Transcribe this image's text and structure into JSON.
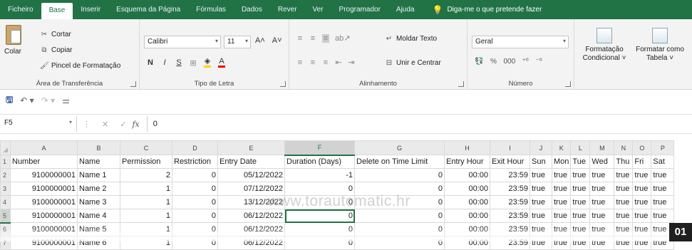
{
  "ribbon_tabs": [
    {
      "label": "Ficheiro",
      "active": false
    },
    {
      "label": "Base",
      "active": true
    },
    {
      "label": "Inserir",
      "active": false
    },
    {
      "label": "Esquema da Página",
      "active": false
    },
    {
      "label": "Fórmulas",
      "active": false
    },
    {
      "label": "Dados",
      "active": false
    },
    {
      "label": "Rever",
      "active": false
    },
    {
      "label": "Ver",
      "active": false
    },
    {
      "label": "Programador",
      "active": false
    },
    {
      "label": "Ajuda",
      "active": false
    }
  ],
  "tell_me": {
    "icon": "lightbulb-icon",
    "label": "Diga-me o que pretende fazer"
  },
  "clipboard": {
    "paste": "Colar",
    "cut": "Cortar",
    "copy": "Copiar",
    "format_painter": "Pincel de Formatação",
    "group_label": "Área de Transferência"
  },
  "font": {
    "name": "Calibri",
    "size": "11",
    "grow": "A˄",
    "shrink": "A˅",
    "bold": "N",
    "italic": "I",
    "underline": "S",
    "group_label": "Tipo de Letra"
  },
  "alignment": {
    "wrap_text": "Moldar Texto",
    "merge_center": "Unir e Centrar",
    "group_label": "Alinhamento"
  },
  "number": {
    "format": "Geral",
    "percent": "%",
    "thousands": "000",
    "group_label": "Número"
  },
  "styles": {
    "conditional_formatting": [
      "Formatação",
      "Condicional ˅"
    ],
    "format_as_table": [
      "Formatar como",
      "Tabela ˅"
    ]
  },
  "colors": {
    "ribbon_green": "#217346",
    "selection_green": "#217346"
  },
  "formula_bar": {
    "name_box": "F5",
    "fx": "fx",
    "value": "0"
  },
  "grid": {
    "column_headers": [
      "A",
      "B",
      "C",
      "D",
      "E",
      "F",
      "G",
      "H",
      "I",
      "J",
      "K",
      "L",
      "M",
      "N",
      "O",
      "P"
    ],
    "rows": [
      {
        "n": "1",
        "cells": [
          "Number",
          "Name",
          "Permission",
          "Restriction",
          "Entry Date",
          "Duration (Days)",
          "Delete on Time Limit",
          "Entry Hour",
          "Exit Hour",
          "Sun",
          "Mon",
          "Tue",
          "Wed",
          "Thu",
          "Fri",
          "Sat"
        ]
      },
      {
        "n": "2",
        "cells": [
          "9100000001",
          "Name 1",
          "2",
          "0",
          "05/12/2022",
          "-1",
          "0",
          "00:00",
          "23:59",
          "true",
          "true",
          "true",
          "true",
          "true",
          "true",
          "true"
        ]
      },
      {
        "n": "3",
        "cells": [
          "9100000001",
          "Name 2",
          "1",
          "0",
          "07/12/2022",
          "0",
          "0",
          "00:00",
          "23:59",
          "true",
          "true",
          "true",
          "true",
          "true",
          "true",
          "true"
        ]
      },
      {
        "n": "4",
        "cells": [
          "9100000001",
          "Name 3",
          "1",
          "0",
          "13/12/2022",
          "0",
          "0",
          "00:00",
          "23:59",
          "true",
          "true",
          "true",
          "true",
          "true",
          "true",
          "true"
        ]
      },
      {
        "n": "5",
        "cells": [
          "9100000001",
          "Name 4",
          "1",
          "0",
          "06/12/2022",
          "0",
          "0",
          "00:00",
          "23:59",
          "true",
          "true",
          "true",
          "true",
          "true",
          "true",
          "true"
        ]
      },
      {
        "n": "6",
        "cells": [
          "9100000001",
          "Name 5",
          "1",
          "0",
          "06/12/2022",
          "0",
          "0",
          "00:00",
          "23:59",
          "true",
          "true",
          "true",
          "true",
          "true",
          "true",
          "true"
        ]
      },
      {
        "n": "7",
        "cells": [
          "9100000001",
          "Name 6",
          "1",
          "0",
          "06/12/2022",
          "0",
          "0",
          "00:00",
          "23:59",
          "true",
          "true",
          "true",
          "true",
          "true",
          "true",
          "true"
        ]
      }
    ]
  },
  "watermark": "www.torautomatic.hr",
  "badge": "01"
}
